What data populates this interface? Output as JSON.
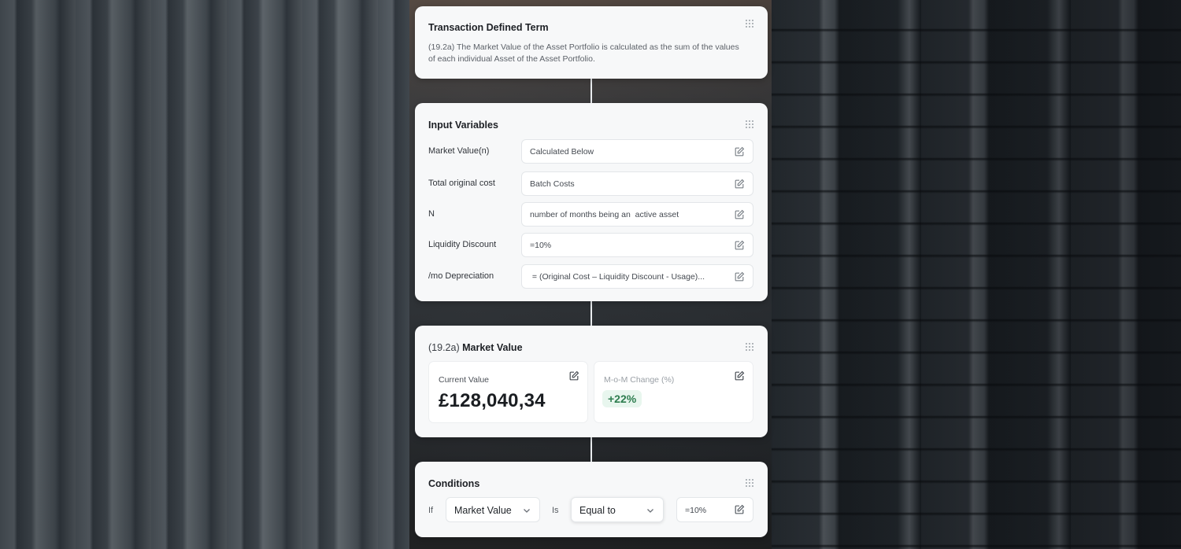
{
  "colors": {
    "card_bg": "#f7f8f9",
    "title_text": "#1d2025",
    "positive_badge_bg": "#e8f6ee",
    "positive_badge_text": "#2e7d4f"
  },
  "term_card": {
    "title": "Transaction Defined Term",
    "description": "(19.2a) The Market Value of the Asset Portfolio is calculated as the sum of the values of each individual Asset of the Asset Portfolio.",
    "drag_icon": "grip-icon"
  },
  "inputs_card": {
    "title": "Input Variables",
    "drag_icon": "grip-icon",
    "variables": [
      {
        "label": "Market Value(n)",
        "value": "Calculated Below",
        "icon": "edit-icon"
      },
      {
        "label": "Total original cost",
        "value": "Batch Costs",
        "icon": "edit-icon"
      },
      {
        "label": "N",
        "value": "number of months being an  active asset",
        "icon": "edit-icon"
      },
      {
        "label": "Liquidity Discount",
        "value": "=10%",
        "icon": "edit-icon"
      },
      {
        "label": "/mo Depreciation",
        "value": " = (Original Cost – Liquidity Discount - Usage)...",
        "icon": "edit-icon"
      }
    ]
  },
  "market_card": {
    "title_prefix": "(19.2a)",
    "title": "Market Value",
    "drag_icon": "grip-icon",
    "current": {
      "label": "Current Value",
      "value": "£128,040,34",
      "icon": "edit-icon"
    },
    "change": {
      "label": "M-o-M Change (%)",
      "value": "+22%",
      "icon": "edit-icon"
    }
  },
  "conditions_card": {
    "title": "Conditions",
    "drag_icon": "grip-icon",
    "if_label": "If",
    "field_select": {
      "value": "Market Value",
      "icon": "chevron-down-icon"
    },
    "is_label": "Is",
    "operator_select": {
      "value": "Equal to",
      "icon": "chevron-down-icon"
    },
    "value_input": {
      "value": "=10%",
      "icon": "edit-icon"
    }
  }
}
